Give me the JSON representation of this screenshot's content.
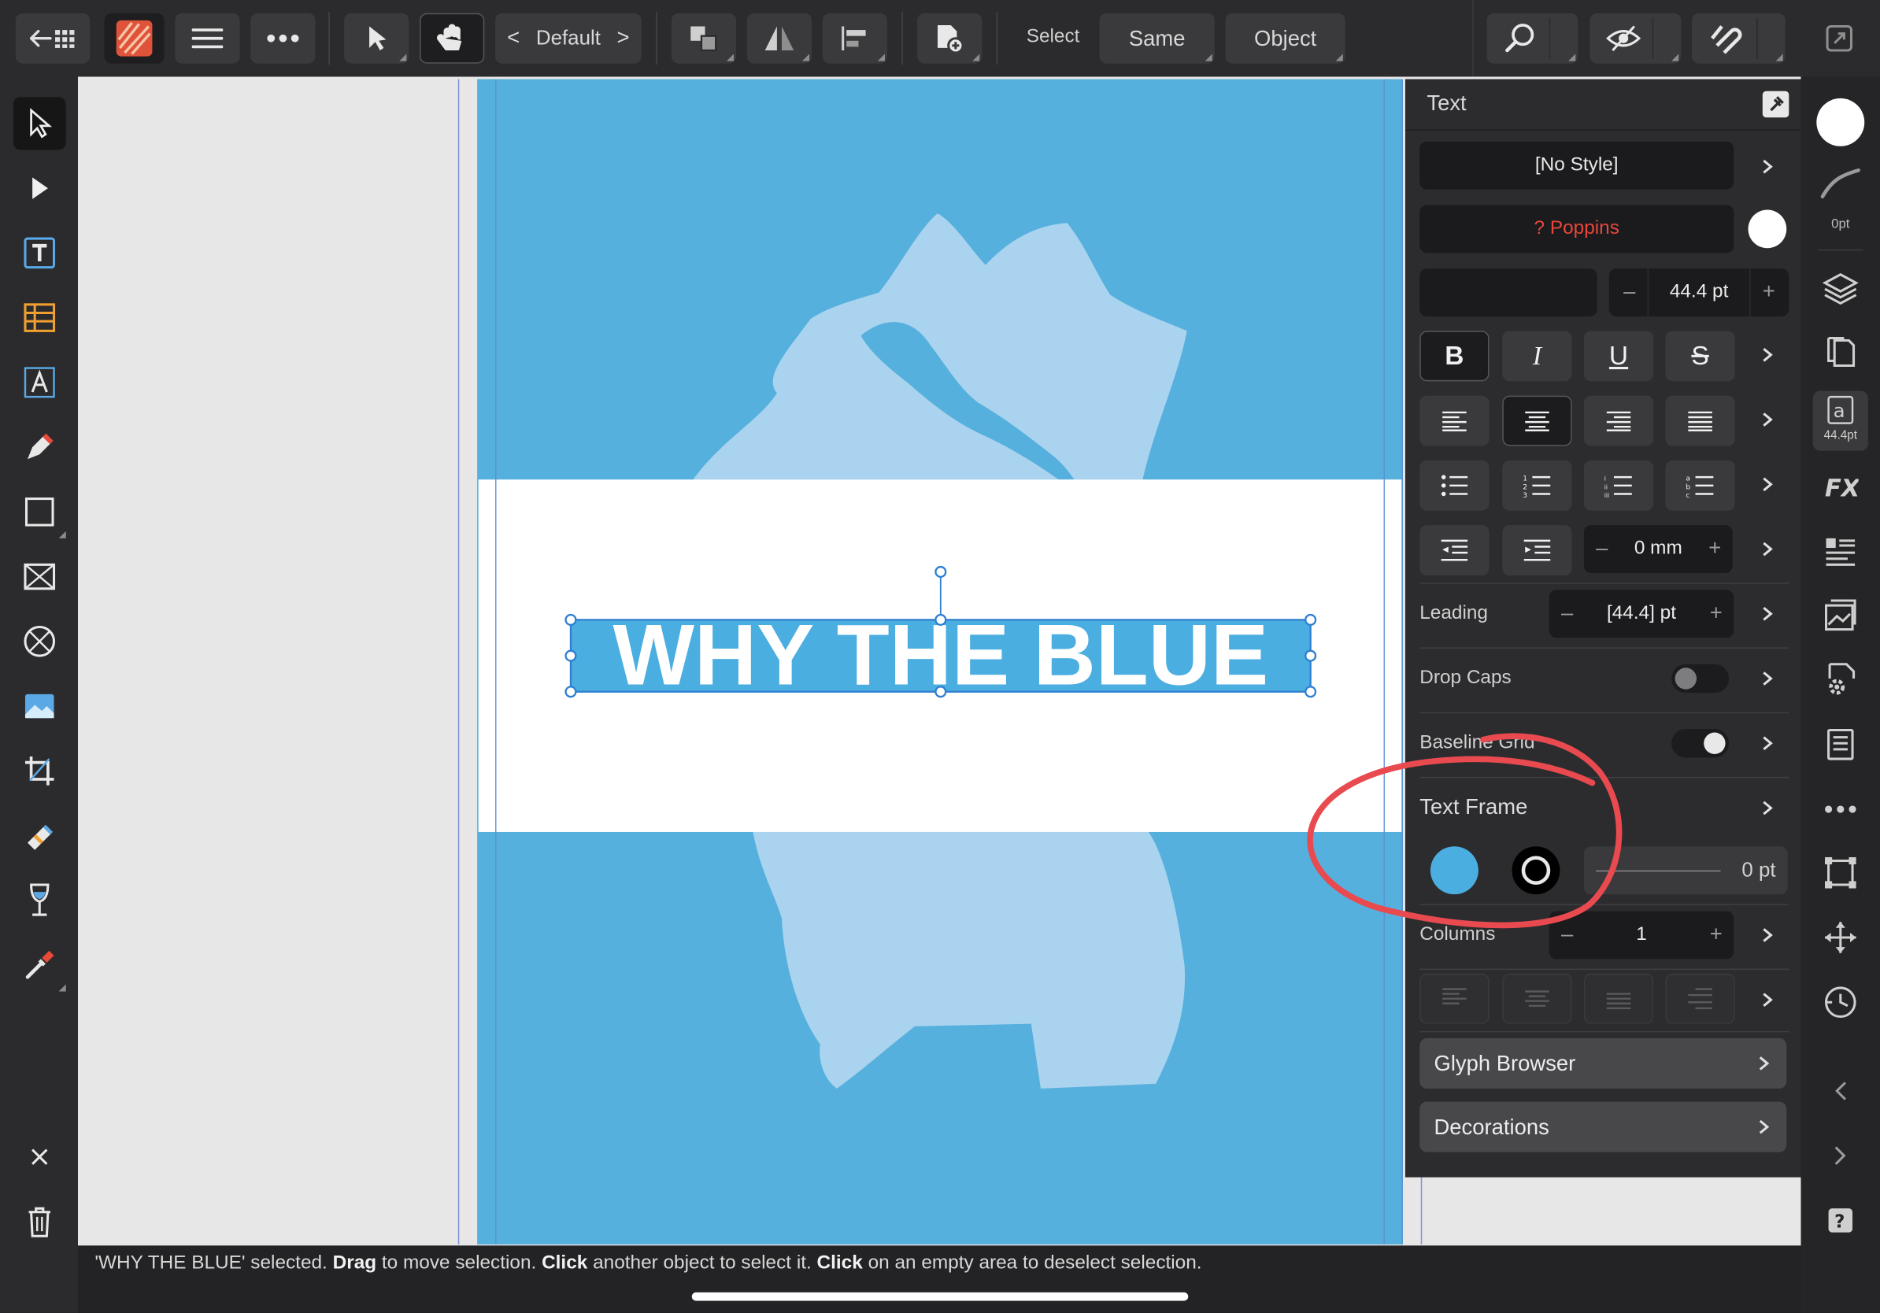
{
  "toolbar": {
    "document_mode": "Default",
    "select_label": "Select",
    "same_label": "Same",
    "object_label": "Object"
  },
  "canvas": {
    "selected_text": "WHY THE BLUE",
    "page_color": "#56b0dd",
    "shape_color": "#a8d3ee"
  },
  "status": {
    "part1": "'WHY THE BLUE' selected. ",
    "drag": "Drag",
    "part2": " to move selection. ",
    "click1": "Click",
    "part3": " another object to select it. ",
    "click2": "Click",
    "part4": " on an empty area to deselect selection."
  },
  "panel": {
    "title": "Text",
    "style": "[No Style]",
    "font": "? Poppins",
    "font_size": "44.4 pt",
    "bold": "B",
    "italic": "I",
    "underline": "U",
    "strike": "S",
    "indent_value": "0 mm",
    "leading_label": "Leading",
    "leading_value": "[44.4] pt",
    "dropcaps_label": "Drop Caps",
    "baseline_label": "Baseline Grid",
    "textframe_label": "Text Frame",
    "frame_fill_color": "#4aaee0",
    "stroke_value": "0 pt",
    "columns_label": "Columns",
    "columns_value": "1",
    "glyph_browser": "Glyph Browser",
    "decorations": "Decorations"
  },
  "studio": {
    "stroke_width": "0pt",
    "char_size": "44.4pt"
  },
  "annotation_color": "#e84a4f"
}
